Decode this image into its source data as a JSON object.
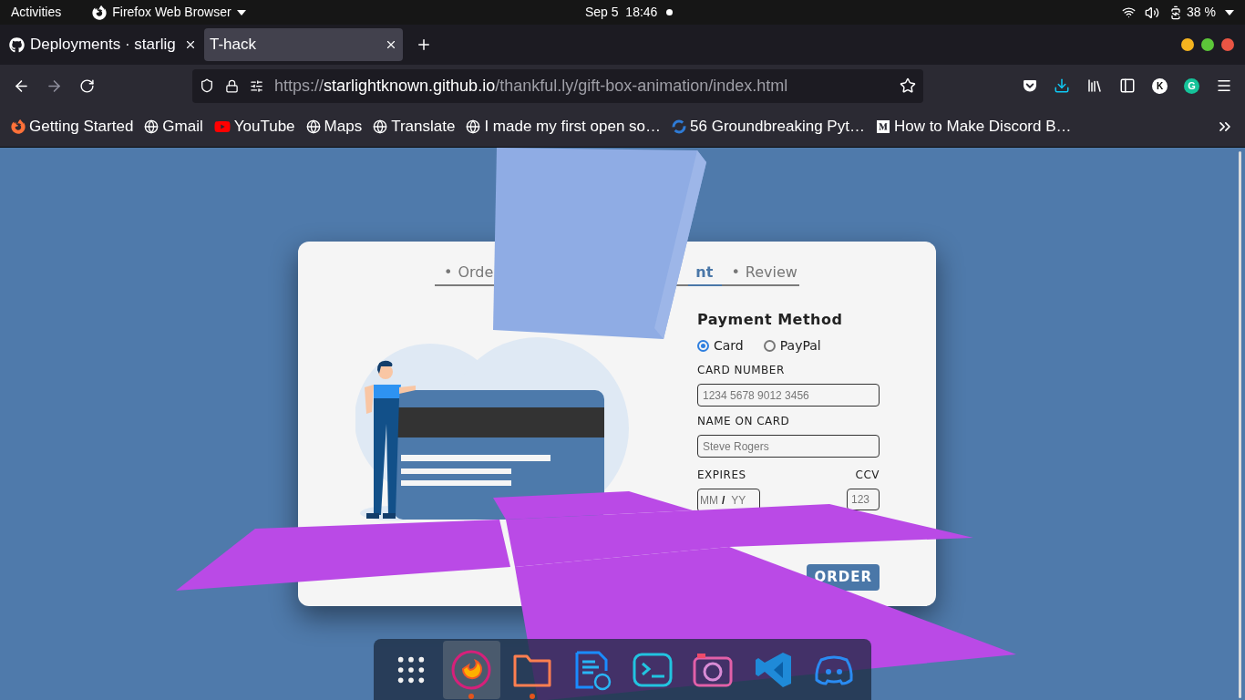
{
  "top_bar": {
    "activities": "Activities",
    "app_menu": "Firefox Web Browser",
    "clock": "Sep 5  18:46",
    "battery": "38 %"
  },
  "tabs": [
    {
      "title": "Deployments · starlig",
      "selected": false,
      "kind": "github"
    },
    {
      "title": "T-hack",
      "selected": true,
      "kind": "plain"
    }
  ],
  "url": {
    "scheme": "https://",
    "host": "starlightknown.github.io",
    "path": "/thankful.ly/gift-box-animation/index.html"
  },
  "toolbar": {
    "account_initial": "K",
    "extension_initial": "G"
  },
  "bookmarks": [
    {
      "label": "Getting Started",
      "kind": "firefox"
    },
    {
      "label": "Gmail",
      "kind": "globe"
    },
    {
      "label": "YouTube",
      "kind": "youtube"
    },
    {
      "label": "Maps",
      "kind": "globe"
    },
    {
      "label": "Translate",
      "kind": "globe"
    },
    {
      "label": "I made my first open so…",
      "kind": "globe"
    },
    {
      "label": "56 Groundbreaking Pyt…",
      "kind": "swirl"
    },
    {
      "label": "How to Make Discord B…",
      "kind": "medium"
    }
  ],
  "checkout": {
    "steps": [
      {
        "bullet": "•",
        "label": "Orde",
        "selected": false
      },
      {
        "label": "nt",
        "selected": true
      },
      {
        "bullet": "•",
        "label": "Review",
        "selected": false
      }
    ],
    "heading": "Payment Method",
    "methods": [
      {
        "label": "Card",
        "selected": true
      },
      {
        "label": "PayPal",
        "selected": false
      }
    ],
    "fields": [
      {
        "label": "CARD NUMBER",
        "placeholder": "1234 5678 9012 3456"
      },
      {
        "label": "NAME ON CARD",
        "placeholder": "Steve Rogers"
      }
    ],
    "expires": {
      "label": "EXPIRES",
      "month_placeholder": "MM",
      "separator": "/",
      "year_placeholder": "YY"
    },
    "ccv": {
      "label": "CCV",
      "placeholder": "123"
    },
    "submit": "ORDER"
  },
  "dock": [
    {
      "kind": "apps",
      "running": false,
      "selected": false
    },
    {
      "kind": "firefox",
      "running": true,
      "selected": true
    },
    {
      "kind": "files",
      "running": true,
      "selected": false
    },
    {
      "kind": "writer",
      "running": false,
      "selected": false
    },
    {
      "kind": "terminal",
      "running": false,
      "selected": false
    },
    {
      "kind": "camera",
      "running": false,
      "selected": false
    },
    {
      "kind": "code",
      "running": false,
      "selected": false
    },
    {
      "kind": "chat",
      "running": false,
      "selected": false
    }
  ]
}
